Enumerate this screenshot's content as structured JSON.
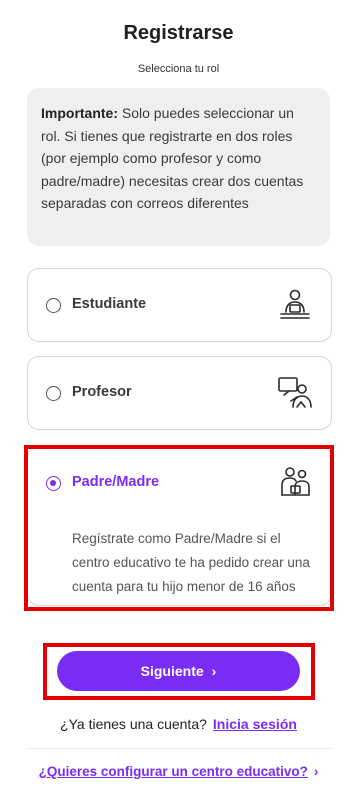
{
  "header": {
    "title": "Registrarse",
    "subtitle": "Selecciona tu rol"
  },
  "notice": {
    "bold": "Importante:",
    "text": " Solo puedes seleccionar un rol. Si tienes que registrarte en dos roles (por ejemplo como profesor y como padre/madre) necesitas crear dos cuentas separadas con correos diferentes"
  },
  "roles": [
    {
      "label": "Estudiante",
      "icon": "student-desk-icon",
      "selected": false
    },
    {
      "label": "Profesor",
      "icon": "teacher-board-icon",
      "selected": false
    },
    {
      "label": "Padre/Madre",
      "icon": "parent-child-icon",
      "selected": true,
      "description": "Regístrate como Padre/Madre si el centro educativo te ha pedido crear una cuenta para tu hijo menor de 16 años"
    }
  ],
  "actions": {
    "next_label": "Siguiente",
    "login_prompt": "¿Ya tienes una cuenta?",
    "login_link": "Inicia sesión",
    "config_link": "¿Quieres configurar un centro educativo?"
  },
  "colors": {
    "accent": "#7b2cf4",
    "highlight": "#e30000"
  }
}
